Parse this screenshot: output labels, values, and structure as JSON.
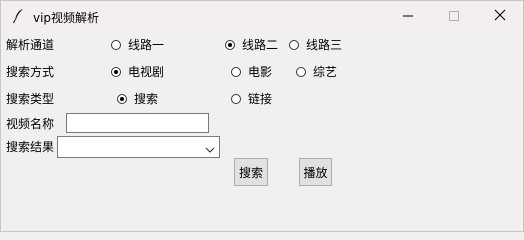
{
  "window": {
    "title": "vip视频解析"
  },
  "channel": {
    "label": "解析通道",
    "options": [
      "线路一",
      "线路二",
      "线路三"
    ],
    "selected": "线路二"
  },
  "search_method": {
    "label": "搜索方式",
    "options": [
      "电视剧",
      "电影",
      "综艺"
    ],
    "selected": "电视剧"
  },
  "search_type": {
    "label": "搜索类型",
    "options": [
      "搜索",
      "链接"
    ],
    "selected": "搜索"
  },
  "video_name": {
    "label": "视频名称",
    "value": ""
  },
  "search_result": {
    "label": "搜索结果",
    "value": ""
  },
  "buttons": {
    "search": "搜索",
    "play": "播放"
  },
  "icons": {
    "app": "feather-icon",
    "minimize": "minimize-icon",
    "maximize": "maximize-icon",
    "close": "close-icon",
    "combo": "chevron-down-icon"
  }
}
